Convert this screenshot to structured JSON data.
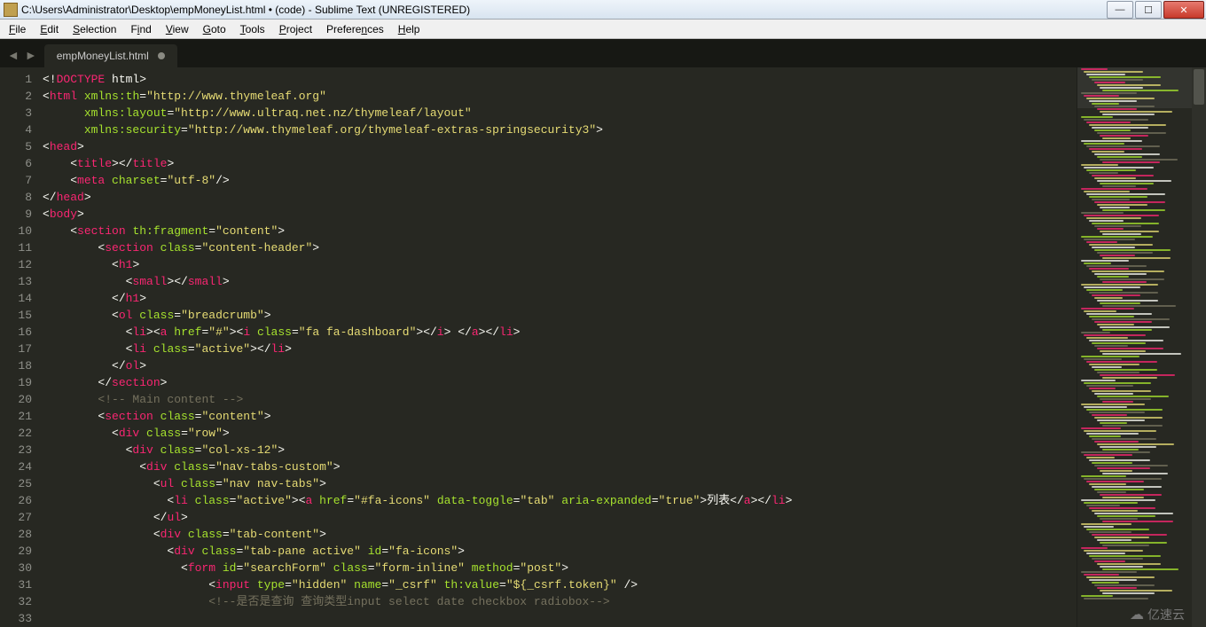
{
  "window": {
    "title": "C:\\Users\\Administrator\\Desktop\\empMoneyList.html • (code) - Sublime Text (UNREGISTERED)"
  },
  "menu": [
    "File",
    "Edit",
    "Selection",
    "Find",
    "View",
    "Goto",
    "Tools",
    "Project",
    "Preferences",
    "Help"
  ],
  "tabs": [
    {
      "label": "empMoneyList.html",
      "dirty": true
    }
  ],
  "line_numbers": [
    "1",
    "2",
    "3",
    "4",
    "5",
    "6",
    "7",
    "8",
    "9",
    "10",
    "11",
    "12",
    "13",
    "14",
    "15",
    "16",
    "17",
    "18",
    "19",
    "20",
    "21",
    "22",
    "23",
    "24",
    "25",
    "26",
    "27",
    "28",
    "29",
    "30",
    "31",
    "32",
    "33"
  ],
  "code": {
    "l1": {
      "a": "<!",
      "b": "DOCTYPE",
      "c": " html",
      "d": ">"
    },
    "l2": {
      "a": "<",
      "b": "html",
      "c": " ",
      "d": "xmlns:th",
      "e": "=",
      "f": "\"http://www.thymeleaf.org\""
    },
    "l3": {
      "a": "      ",
      "b": "xmlns:layout",
      "c": "=",
      "d": "\"http://www.ultraq.net.nz/thymeleaf/layout\""
    },
    "l4": {
      "a": "      ",
      "b": "xmlns:security",
      "c": "=",
      "d": "\"http://www.thymeleaf.org/thymeleaf-extras-springsecurity3\"",
      "e": ">"
    },
    "l5": {
      "a": "<",
      "b": "head",
      "c": ">"
    },
    "l6": {
      "a": "    <",
      "b": "title",
      "c": "></",
      "d": "title",
      "e": ">"
    },
    "l7": {
      "a": "    <",
      "b": "meta",
      "c": " ",
      "d": "charset",
      "e": "=",
      "f": "\"utf-8\"",
      "g": "/>"
    },
    "l8": {
      "a": "</",
      "b": "head",
      "c": ">"
    },
    "l9": {
      "a": "<",
      "b": "body",
      "c": ">"
    },
    "l10": {
      "a": "    <",
      "b": "section",
      "c": " ",
      "d": "th:fragment",
      "e": "=",
      "f": "\"content\"",
      "g": ">"
    },
    "l11": {
      "a": "        <",
      "b": "section",
      "c": " ",
      "d": "class",
      "e": "=",
      "f": "\"content-header\"",
      "g": ">"
    },
    "l12": {
      "a": "          <",
      "b": "h1",
      "c": ">"
    },
    "l13": {
      "a": "            <",
      "b": "small",
      "c": "></",
      "d": "small",
      "e": ">"
    },
    "l14": {
      "a": "          </",
      "b": "h1",
      "c": ">"
    },
    "l15": {
      "a": "          <",
      "b": "ol",
      "c": " ",
      "d": "class",
      "e": "=",
      "f": "\"breadcrumb\"",
      "g": ">"
    },
    "l16": {
      "a": "            <",
      "b": "li",
      "c": "><",
      "d": "a",
      "e": " ",
      "f": "href",
      "g": "=",
      "h": "\"#\"",
      "i": "><",
      "j": "i",
      "k": " ",
      "l": "class",
      "m": "=",
      "n": "\"fa fa-dashboard\"",
      "o": "></",
      "p": "i",
      "q": "> </",
      "r": "a",
      "s": "></",
      "t": "li",
      "u": ">"
    },
    "l17": {
      "a": "            <",
      "b": "li",
      "c": " ",
      "d": "class",
      "e": "=",
      "f": "\"active\"",
      "g": "></",
      "h": "li",
      "i": ">"
    },
    "l18": {
      "a": "          </",
      "b": "ol",
      "c": ">"
    },
    "l19": {
      "a": "        </",
      "b": "section",
      "c": ">"
    },
    "l20": {
      "a": ""
    },
    "l21": {
      "a": "        ",
      "b": "<!-- Main content -->"
    },
    "l22": {
      "a": "        <",
      "b": "section",
      "c": " ",
      "d": "class",
      "e": "=",
      "f": "\"content\"",
      "g": ">"
    },
    "l23": {
      "a": "          <",
      "b": "div",
      "c": " ",
      "d": "class",
      "e": "=",
      "f": "\"row\"",
      "g": ">"
    },
    "l24": {
      "a": "            <",
      "b": "div",
      "c": " ",
      "d": "class",
      "e": "=",
      "f": "\"col-xs-12\"",
      "g": ">"
    },
    "l25": {
      "a": "              <",
      "b": "div",
      "c": " ",
      "d": "class",
      "e": "=",
      "f": "\"nav-tabs-custom\"",
      "g": ">"
    },
    "l26": {
      "a": "                <",
      "b": "ul",
      "c": " ",
      "d": "class",
      "e": "=",
      "f": "\"nav nav-tabs\"",
      "g": ">"
    },
    "l27": {
      "a": "                  <",
      "b": "li",
      "c": " ",
      "d": "class",
      "e": "=",
      "f": "\"active\"",
      "g": "><",
      "h": "a",
      "i": " ",
      "j": "href",
      "k": "=",
      "l": "\"#fa-icons\"",
      "m": " ",
      "n": "data-toggle",
      "o": "=",
      "p": "\"tab\"",
      "q": " ",
      "r": "aria-expanded",
      "s": "=",
      "t": "\"true\"",
      "u": ">",
      "v": "列表",
      "w": "</",
      "x": "a",
      "y": "></",
      "z": "li",
      "aa": ">"
    },
    "l28": {
      "a": "                </",
      "b": "ul",
      "c": ">"
    },
    "l29": {
      "a": "                <",
      "b": "div",
      "c": " ",
      "d": "class",
      "e": "=",
      "f": "\"tab-content\"",
      "g": ">"
    },
    "l30": {
      "a": "                  <",
      "b": "div",
      "c": " ",
      "d": "class",
      "e": "=",
      "f": "\"tab-pane active\"",
      "g": " ",
      "h": "id",
      "i": "=",
      "j": "\"fa-icons\"",
      "k": ">"
    },
    "l31": {
      "a": "                    <",
      "b": "form",
      "c": " ",
      "d": "id",
      "e": "=",
      "f": "\"searchForm\"",
      "g": " ",
      "h": "class",
      "i": "=",
      "j": "\"form-inline\"",
      "k": " ",
      "l": "method",
      "m": "=",
      "n": "\"post\"",
      "o": ">"
    },
    "l32": {
      "a": "                        <",
      "b": "input",
      "c": " ",
      "d": "type",
      "e": "=",
      "f": "\"hidden\"",
      "g": " ",
      "h": "name",
      "i": "=",
      "j": "\"_csrf\"",
      "k": " ",
      "l": "th:value",
      "m": "=",
      "n": "\"${_csrf.token}\"",
      "o": " />"
    },
    "l33": {
      "a": "                        ",
      "b": "<!--是否是查询 查询类型input select date checkbox radiobox-->"
    }
  },
  "watermark": "亿速云"
}
